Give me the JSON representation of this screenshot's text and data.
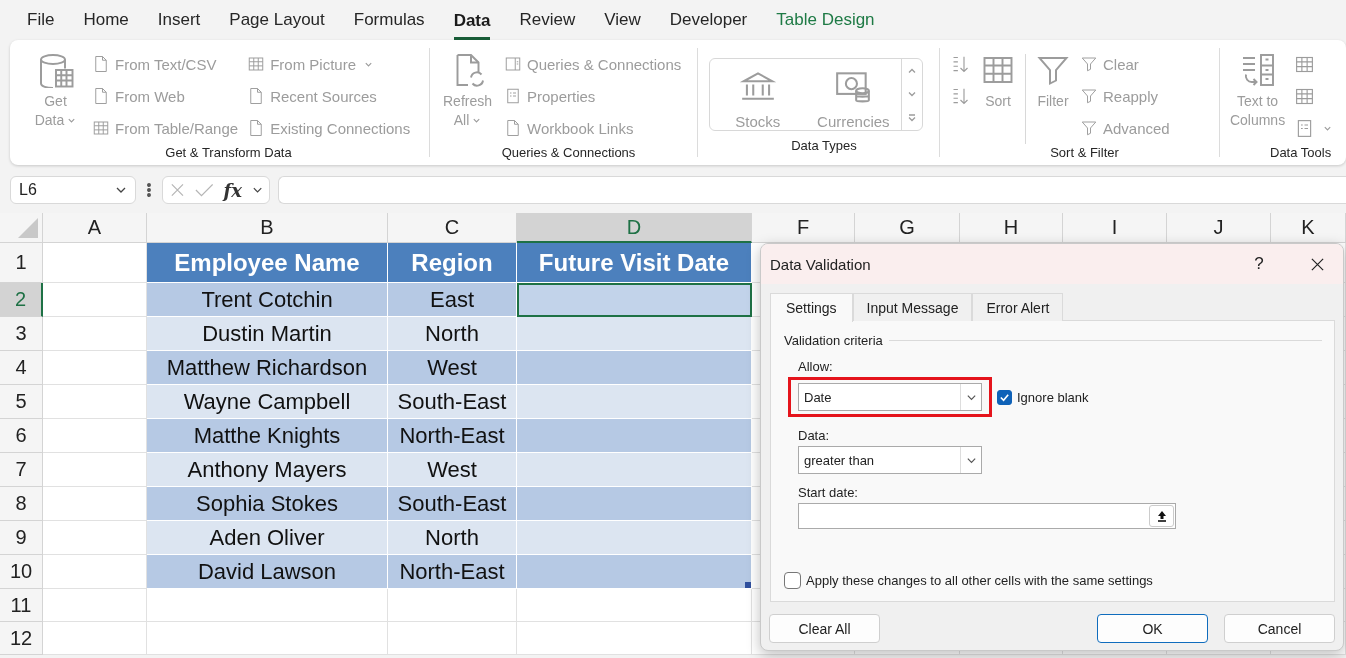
{
  "menu_tabs": [
    {
      "label": "File",
      "kind": "normal",
      "selected": false
    },
    {
      "label": "Home",
      "kind": "normal",
      "selected": false
    },
    {
      "label": "Insert",
      "kind": "normal",
      "selected": false
    },
    {
      "label": "Page Layout",
      "kind": "normal",
      "selected": false
    },
    {
      "label": "Formulas",
      "kind": "normal",
      "selected": false
    },
    {
      "label": "Data",
      "kind": "normal",
      "selected": true
    },
    {
      "label": "Review",
      "kind": "normal",
      "selected": false
    },
    {
      "label": "View",
      "kind": "normal",
      "selected": false
    },
    {
      "label": "Developer",
      "kind": "normal",
      "selected": false
    },
    {
      "label": "Table Design",
      "kind": "contextual",
      "selected": false
    }
  ],
  "ribbon": {
    "disabled": true,
    "groups": [
      {
        "label": "Get & Transform Data",
        "columns": [
          {
            "kind": "large",
            "items": [
              {
                "label": "Get Data",
                "dropdown": true
              }
            ]
          },
          {
            "kind": "stack",
            "items": [
              {
                "label": "From Text/CSV"
              },
              {
                "label": "From Web"
              },
              {
                "label": "From Table/Range"
              }
            ]
          },
          {
            "kind": "stack",
            "items": [
              {
                "label": "From Picture",
                "dropdown": true
              },
              {
                "label": "Recent Sources"
              },
              {
                "label": "Existing Connections"
              }
            ]
          }
        ]
      },
      {
        "label": "Queries & Connections",
        "columns": [
          {
            "kind": "large",
            "items": [
              {
                "label": "Refresh All",
                "dropdown": true
              }
            ]
          },
          {
            "kind": "stack",
            "items": [
              {
                "label": "Queries & Connections"
              },
              {
                "label": "Properties"
              },
              {
                "label": "Workbook Links"
              }
            ]
          }
        ]
      },
      {
        "label": "Data Types",
        "columns": [
          {
            "kind": "gallery",
            "items": [
              {
                "label": "Stocks"
              },
              {
                "label": "Currencies"
              }
            ]
          }
        ]
      },
      {
        "label": "Sort & Filter",
        "columns": [
          {
            "kind": "stack",
            "items": [
              {
                "kind": "icon"
              },
              {
                "kind": "icon"
              }
            ]
          },
          {
            "kind": "large",
            "items": [
              {
                "label": "Sort"
              }
            ]
          },
          {
            "kind": "separator"
          },
          {
            "kind": "large",
            "items": [
              {
                "label": "Filter"
              }
            ]
          },
          {
            "kind": "stack",
            "items": [
              {
                "label": "Clear"
              },
              {
                "label": "Reapply"
              },
              {
                "label": "Advanced"
              }
            ]
          }
        ]
      },
      {
        "label": "Data Tools",
        "columns": [
          {
            "kind": "large",
            "items": [
              {
                "label": "Text to Columns"
              }
            ]
          },
          {
            "kind": "stack",
            "items": [
              {
                "kind": "icon"
              },
              {
                "kind": "icon"
              },
              {
                "kind": "icon",
                "dropdown": true
              }
            ]
          }
        ]
      }
    ]
  },
  "formula_bar": {
    "name_box": "L6",
    "function_label": "fx"
  },
  "sheet": {
    "columns": [
      {
        "label": "A",
        "selected": false
      },
      {
        "label": "B",
        "selected": false
      },
      {
        "label": "C",
        "selected": false
      },
      {
        "label": "D",
        "selected": true
      },
      {
        "label": "F",
        "selected": false
      },
      {
        "label": "G",
        "selected": false
      },
      {
        "label": "H",
        "selected": false
      },
      {
        "label": "I",
        "selected": false
      },
      {
        "label": "J",
        "selected": false
      },
      {
        "label": "K",
        "selected": false
      }
    ],
    "rows": [
      {
        "label": "1",
        "selected": false
      },
      {
        "label": "2",
        "selected": true
      },
      {
        "label": "3",
        "selected": false
      },
      {
        "label": "4",
        "selected": false
      },
      {
        "label": "5",
        "selected": false
      },
      {
        "label": "6",
        "selected": false
      },
      {
        "label": "7",
        "selected": false
      },
      {
        "label": "8",
        "selected": false
      },
      {
        "label": "9",
        "selected": false
      },
      {
        "label": "10",
        "selected": false
      },
      {
        "label": "11",
        "selected": false
      },
      {
        "label": "12",
        "selected": false
      }
    ]
  },
  "table": {
    "columns": [
      "Employee Name",
      "Region",
      "Future Visit Date"
    ],
    "rows": [
      {
        "cells": [
          {
            "text": "Trent Cotchin",
            "active": false
          },
          {
            "text": "East",
            "active": false
          },
          {
            "active": true
          }
        ]
      },
      {
        "cells": [
          {
            "text": "Dustin Martin",
            "active": false
          },
          {
            "text": "North",
            "active": false
          },
          {
            "active": false
          }
        ]
      },
      {
        "cells": [
          {
            "text": "Matthew Richardson",
            "active": false
          },
          {
            "text": "West",
            "active": false
          },
          {
            "active": false
          }
        ]
      },
      {
        "cells": [
          {
            "text": "Wayne Campbell",
            "active": false
          },
          {
            "text": "South-East",
            "active": false
          },
          {
            "active": false
          }
        ]
      },
      {
        "cells": [
          {
            "text": "Matthe Knights",
            "active": false
          },
          {
            "text": "North-East",
            "active": false
          },
          {
            "active": false
          }
        ]
      },
      {
        "cells": [
          {
            "text": "Anthony Mayers",
            "active": false
          },
          {
            "text": "West",
            "active": false
          },
          {
            "active": false
          }
        ]
      },
      {
        "cells": [
          {
            "text": "Sophia Stokes",
            "active": false
          },
          {
            "text": "South-East",
            "active": false
          },
          {
            "active": false
          }
        ]
      },
      {
        "cells": [
          {
            "text": "Aden Oliver",
            "active": false
          },
          {
            "text": "North",
            "active": false
          },
          {
            "active": false
          }
        ]
      },
      {
        "cells": [
          {
            "text": "David Lawson",
            "active": false
          },
          {
            "text": "North-East",
            "active": false
          },
          {
            "active": false
          }
        ]
      }
    ]
  },
  "dialog": {
    "title": "Data Validation",
    "help": "?",
    "tabs": [
      {
        "label": "Settings",
        "selected": true
      },
      {
        "label": "Input Message",
        "selected": false
      },
      {
        "label": "Error Alert",
        "selected": false
      }
    ],
    "section": "Validation criteria",
    "allow": {
      "label": "Allow:",
      "value": "Date",
      "highlighted": true
    },
    "ignore_blank": {
      "label": "Ignore blank",
      "checked": true
    },
    "data": {
      "label": "Data:",
      "value": "greater than"
    },
    "start_date": {
      "label": "Start date:"
    },
    "apply_all": {
      "label": "Apply these changes to all other cells with the same settings",
      "checked": false
    },
    "buttons": [
      {
        "label": "Clear All",
        "kind": "left"
      },
      {
        "label": "OK",
        "kind": "default"
      },
      {
        "label": "Cancel",
        "kind": "normal"
      }
    ]
  }
}
